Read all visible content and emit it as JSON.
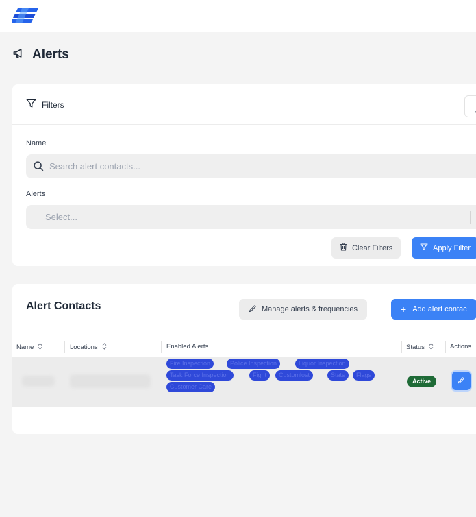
{
  "page": {
    "title": "Alerts",
    "title_icon": "megaphone-icon"
  },
  "filters": {
    "title": "Filters",
    "name_label": "Name",
    "search_placeholder": "Search alert contacts...",
    "alerts_label": "Alerts",
    "alerts_placeholder": "Select...",
    "clear_label": "Clear Filters",
    "apply_label": "Apply Filter"
  },
  "contacts": {
    "title": "Alert Contacts",
    "manage_label": "Manage alerts & frequencies",
    "add_label": "Add alert contac",
    "columns": [
      "Name",
      "Locations",
      "Enabled Alerts",
      "Status",
      "Actions"
    ],
    "rows": [
      {
        "alerts": [
          "Fire Inspection",
          "Police Inspection",
          "Liquor Inspection",
          "Task Force Inspection",
          "Fight",
          "Customlost",
          "Stats",
          "Flags",
          "Customer Care"
        ],
        "status": "Active"
      }
    ]
  },
  "colors": {
    "primary": "#3b82f6",
    "tag": "#2f49d9",
    "active": "#1f6b37"
  }
}
